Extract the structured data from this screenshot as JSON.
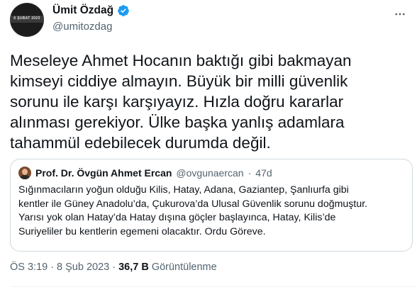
{
  "author": {
    "display_name": "Ümit Özdağ",
    "handle": "@umitozdag",
    "avatar_text": "6 ŞUBAT 2023"
  },
  "tweet": {
    "text": "Meseleye Ahmet Hocanın baktığı gibi bakmayan\nkimseyi ciddiye almayın. Büyük bir milli güvenlik\nsorunu ile karşı karşıyayız. Hızla doğru kararlar\nalınması gerekiyor. Ülke başka yanlış adamlara\ntahammül edebilecek durumda değil."
  },
  "quote": {
    "name": "Prof. Dr. Övgün Ahmet Ercan",
    "handle": "@ovgunaercan",
    "separator": "·",
    "age": "47d",
    "text": "Sığınmacıların yoğun olduğu Kilis, Hatay, Adana, Gaziantep, Şanlıurfa gibi\nkentler ile Güney Anadolu’da, Çukurova’da Ulusal Güvenlik sorunu doğmuştur.\nYarısı yok olan Hatay’da Hatay dışına göçler başlayınca, Hatay, Kilis’de\nSuriyeliler bu kentlerin egemeni olacaktır. Ordu Göreve."
  },
  "meta": {
    "time": "ÖS 3:19",
    "separator": "·",
    "date": "8 Şub 2023",
    "views_count": "36,7 B",
    "views_label": "Görüntülenme"
  },
  "icons": {
    "verified": "verified-badge-icon",
    "more": "more-options-icon"
  },
  "colors": {
    "text_primary": "#0f1419",
    "text_secondary": "#536471",
    "verified_blue": "#1d9bf0",
    "border": "#cfd9de"
  }
}
